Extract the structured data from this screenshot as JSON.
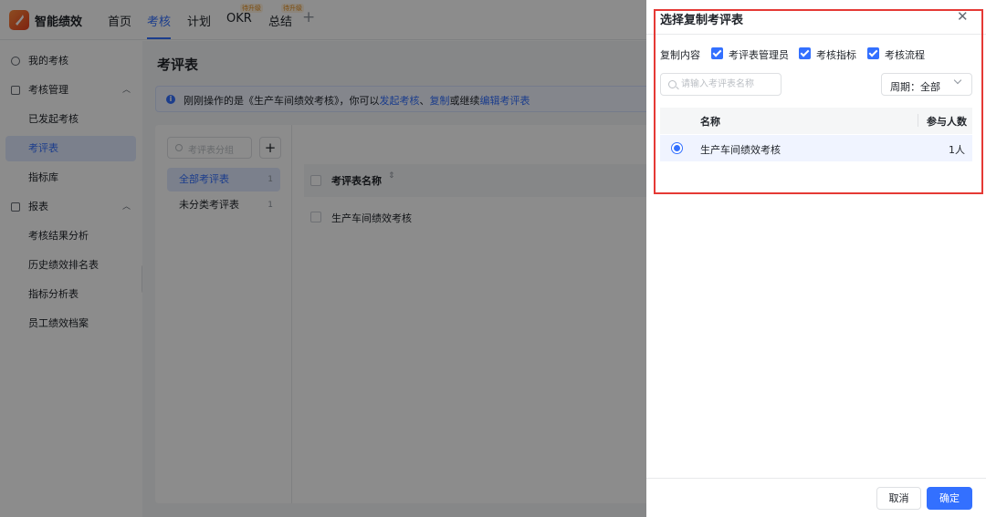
{
  "app": {
    "name": "智能绩效",
    "nav": [
      "首页",
      "考核",
      "计划",
      "OKR",
      "总结"
    ],
    "nav_badge": "待升级"
  },
  "sidebar": {
    "items": [
      {
        "label": "我的考核"
      },
      {
        "label": "考核管理"
      },
      {
        "label": "已发起考核"
      },
      {
        "label": "考评表"
      },
      {
        "label": "指标库"
      },
      {
        "label": "报表"
      },
      {
        "label": "考核结果分析"
      },
      {
        "label": "历史绩效排名表"
      },
      {
        "label": "指标分析表"
      },
      {
        "label": "员工绩效档案"
      }
    ]
  },
  "main": {
    "title": "考评表",
    "notice": {
      "prefix": "刚刚操作的是《生产车间绩效考核》，你可以",
      "link1": "发起考核",
      "sep": "、",
      "link2": "复制",
      "mid": "或继续",
      "link3": "编辑考评表"
    },
    "category_search_placeholder": "考评表分组",
    "categories": [
      {
        "label": "全部考评表",
        "count": "1"
      },
      {
        "label": "未分类考评表",
        "count": "1"
      }
    ],
    "table_header": "考评表名称",
    "rows": [
      "生产车间绩效考核"
    ]
  },
  "drawer": {
    "title": "选择复制考评表",
    "copy_label": "复制内容",
    "options": [
      "考评表管理员",
      "考核指标",
      "考核流程"
    ],
    "search_placeholder": "请输入考评表名称",
    "period_label": "周期：全部",
    "col_name": "名称",
    "col_count": "参与人数",
    "rows": [
      {
        "name": "生产车间绩效考核",
        "count": "1人"
      }
    ],
    "cancel": "取消",
    "confirm": "确定"
  },
  "colors": {
    "accent": "#3370ff",
    "highlight": "#e53935"
  }
}
